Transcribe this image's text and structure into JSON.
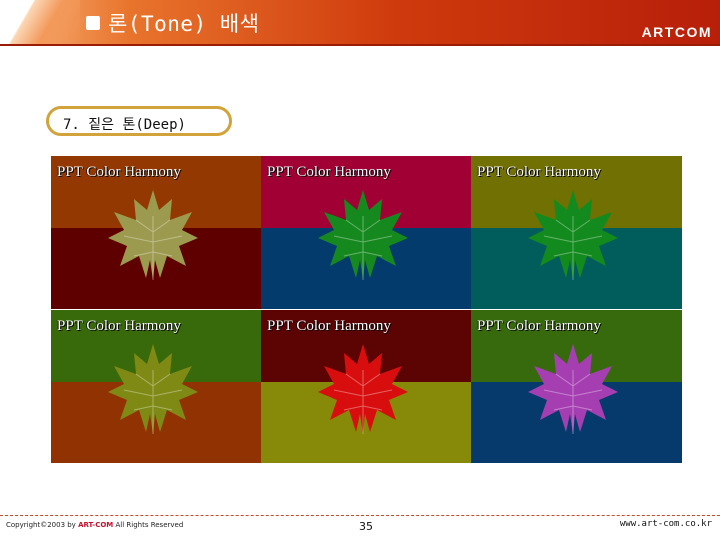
{
  "header": {
    "title": "론(Tone) 배색",
    "brand": "ARTCOM",
    "bullet_icon": "square-bullet-icon"
  },
  "section": {
    "label": "7. 짙은 톤(Deep)"
  },
  "tiles": [
    {
      "caption": "PPT Color Harmony",
      "top_color": "#933800",
      "bottom_color": "#5e0000",
      "leaf_color": "#9c9a4e"
    },
    {
      "caption": "PPT Color Harmony",
      "top_color": "#a00034",
      "bottom_color": "#033b6d",
      "leaf_color": "#16891e"
    },
    {
      "caption": "PPT Color Harmony",
      "top_color": "#707102",
      "bottom_color": "#015d5b",
      "leaf_color": "#138a1d"
    },
    {
      "caption": "PPT Color Harmony",
      "top_color": "#386a0c",
      "bottom_color": "#913202",
      "leaf_color": "#7f8a15"
    },
    {
      "caption": "PPT Color Harmony",
      "top_color": "#5c0404",
      "bottom_color": "#878a08",
      "leaf_color": "#d80e0e"
    },
    {
      "caption": "PPT Color Harmony",
      "top_color": "#376a0c",
      "bottom_color": "#063a6c",
      "leaf_color": "#a53fb1"
    }
  ],
  "footer": {
    "copyright_prefix": "Copyright©2003 by ",
    "copyright_brand": "ART-COM",
    "copyright_suffix": " All Rights Reserved",
    "page_number": "35",
    "website": "www.art-com.co.kr"
  }
}
